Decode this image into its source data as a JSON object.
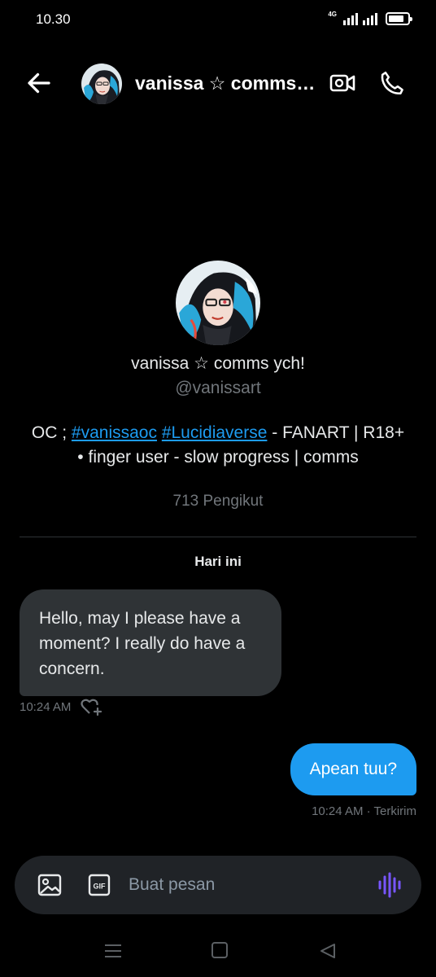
{
  "status": {
    "time": "10.30",
    "network": "4G",
    "battery_level": 0.8
  },
  "header": {
    "title": "vanissa ☆ comms ych!"
  },
  "profile": {
    "name": "vanissa ☆ comms ych!",
    "handle": "@vanissart",
    "bio_prefix": "OC ; ",
    "hashtag1": "#vanissaoc",
    "hashtag2": "#Lucidiaverse",
    "bio_rest": " - FANART | R18+ • finger user - slow progress | comms",
    "followers": "713 Pengikut"
  },
  "conversation": {
    "day_label": "Hari ini",
    "messages": [
      {
        "direction": "in",
        "text": "Hello, may I please have a moment? I really do have a concern.",
        "time": "10:24 AM"
      },
      {
        "direction": "out",
        "text": "Apean tuu?",
        "meta": "10:24 AM · Terkirim"
      }
    ]
  },
  "composer": {
    "placeholder": "Buat pesan",
    "gif_label": "GIF"
  },
  "colors": {
    "accent": "#1d9bf0",
    "bubble_in": "#2f3336",
    "voice": "#7856ff"
  },
  "icons": [
    "back-arrow-icon",
    "video-call-icon",
    "phone-icon",
    "react-heart-icon",
    "image-icon",
    "gif-icon",
    "voice-icon",
    "menu-icon",
    "home-icon",
    "nav-back-icon"
  ]
}
